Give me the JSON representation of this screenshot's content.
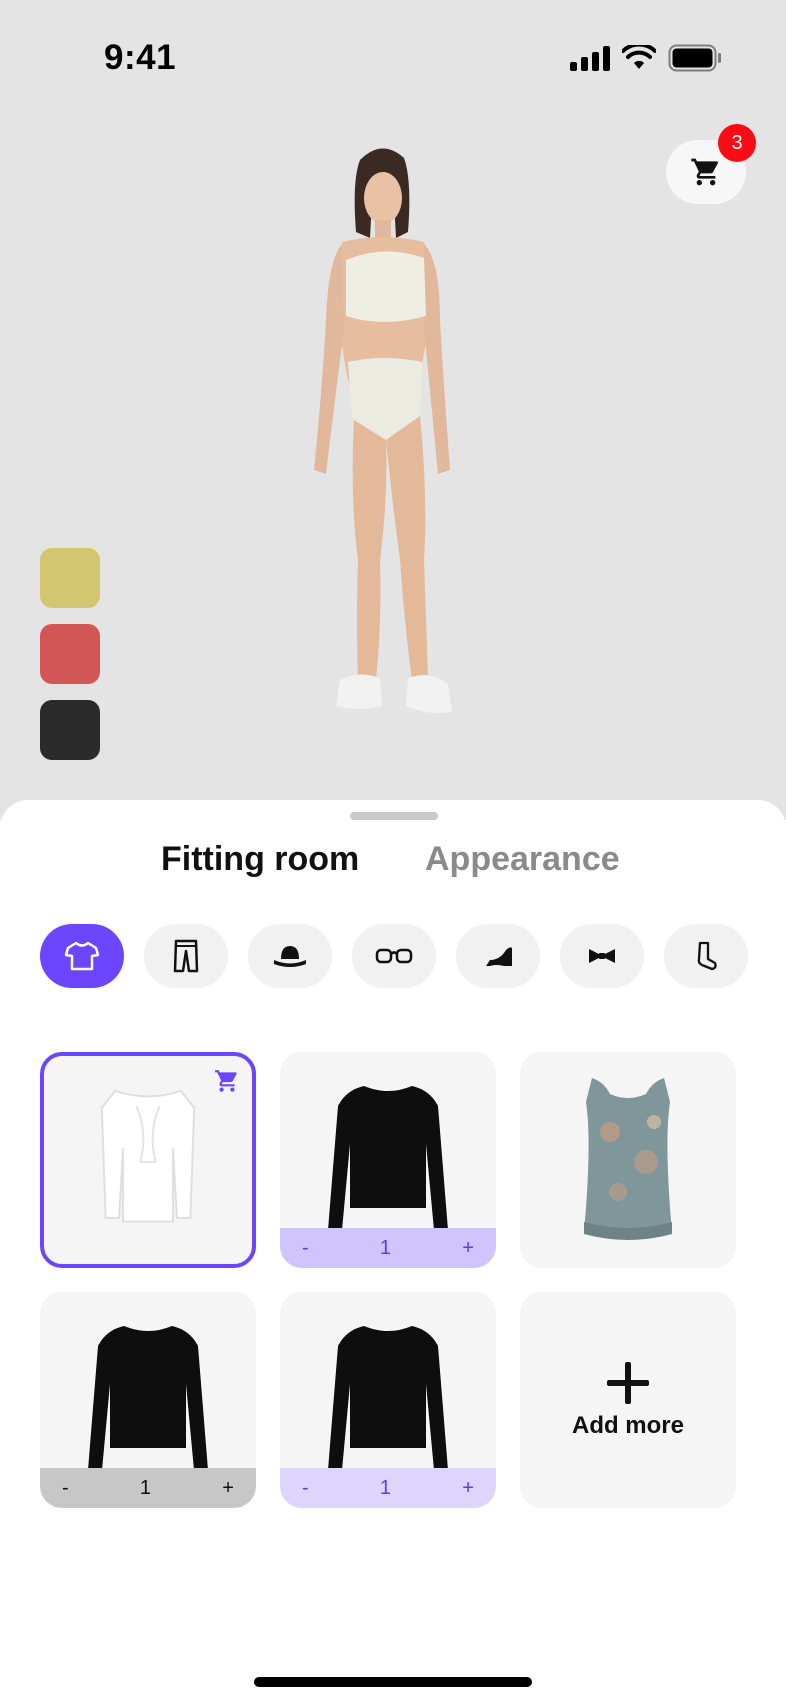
{
  "status_bar": {
    "time": "9:41",
    "icons": [
      "cellular-signal-icon",
      "wifi-icon",
      "battery-icon"
    ]
  },
  "cart": {
    "icon": "cart-icon",
    "badge_count": "3",
    "badge_color": "#ff0a14"
  },
  "model": {
    "description_icon": "model-photo"
  },
  "swatches": [
    {
      "name": "mustard",
      "color": "#d4c670"
    },
    {
      "name": "red",
      "color": "#d35656"
    },
    {
      "name": "black",
      "color": "#2b2b2b"
    }
  ],
  "tabs": {
    "active": "Fitting room",
    "inactive": "Appearance"
  },
  "categories": [
    {
      "icon": "tshirt-icon",
      "active": true
    },
    {
      "icon": "pants-icon",
      "active": false
    },
    {
      "icon": "hat-icon",
      "active": false
    },
    {
      "icon": "glasses-icon",
      "active": false
    },
    {
      "icon": "heel-shoe-icon",
      "active": false
    },
    {
      "icon": "bowtie-icon",
      "active": false
    },
    {
      "icon": "sock-icon",
      "active": false
    }
  ],
  "items": [
    {
      "garment": "white-top",
      "selected": true,
      "in_cart_icon": "cart-icon"
    },
    {
      "garment": "black-longsleeve",
      "qty": {
        "minus": "-",
        "value": "1",
        "plus": "+"
      }
    },
    {
      "garment": "printed-sleeveless-top"
    },
    {
      "garment": "black-longsleeve",
      "qty": {
        "minus": "-",
        "value": "1",
        "plus": "+"
      }
    },
    {
      "garment": "black-longsleeve",
      "qty": {
        "minus": "-",
        "value": "1",
        "plus": "+"
      }
    }
  ],
  "add_more": {
    "icon": "plus-icon",
    "label": "Add more"
  },
  "colors": {
    "accent": "#6b45ff",
    "accent_light": "#cfc4fb",
    "background": "#e4e4e4"
  }
}
